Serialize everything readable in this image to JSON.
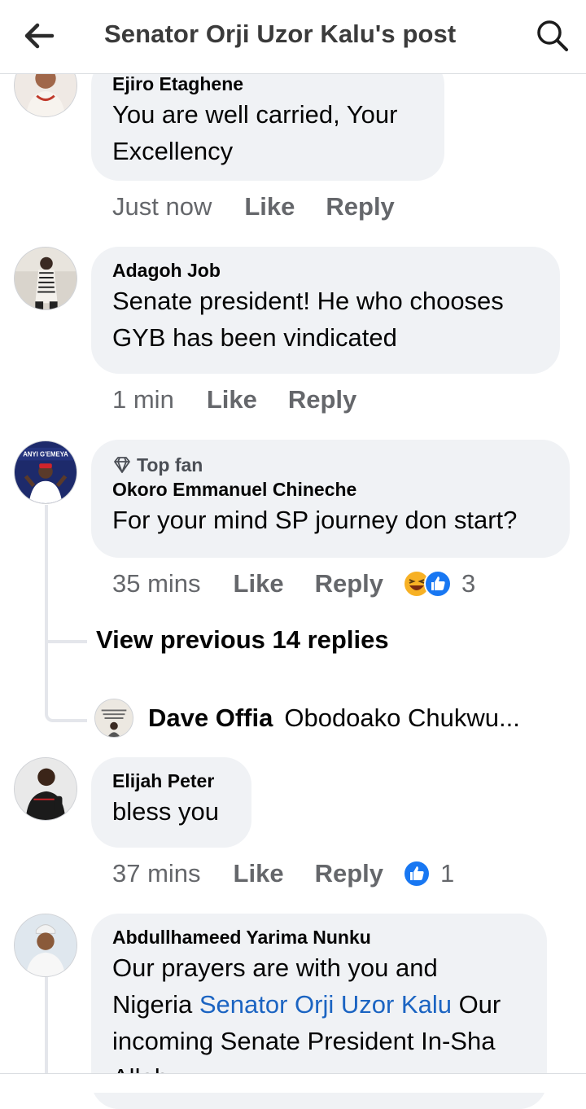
{
  "header": {
    "title": "Senator Orji Uzor Kalu's post"
  },
  "comments": [
    {
      "author": "Ejiro Etaghene",
      "lines": [
        "You are well carried, Your",
        "Excellency"
      ],
      "time": "Just now",
      "like": "Like",
      "reply": "Reply"
    },
    {
      "author": "Adagoh Job",
      "lines": [
        "Senate president! He who chooses",
        "GYB has been vindicated"
      ],
      "time": "1 min",
      "like": "Like",
      "reply": "Reply"
    },
    {
      "badge": "Top fan",
      "author": "Okoro Emmanuel Chineche",
      "lines": [
        "For your mind SP journey don start?"
      ],
      "time": "35 mins",
      "like": "Like",
      "reply": "Reply",
      "reaction_count": "3",
      "reactions": [
        "laugh-reaction",
        "like-reaction"
      ]
    },
    {
      "author": "Elijah Peter",
      "lines": [
        "bless you"
      ],
      "time": "37 mins",
      "like": "Like",
      "reply": "Reply",
      "reaction_count": "1",
      "reactions": [
        "like-reaction"
      ]
    },
    {
      "author": "Abdullhameed Yarima Nunku",
      "line1": "Our prayers are with you and",
      "line2_prefix": "Nigeria ",
      "mention": "Senator Orji Uzor Kalu",
      "line2_suffix": " Our",
      "line3": "incoming Senate President In-Sha",
      "line4": "Allah"
    }
  ],
  "thread": {
    "view_previous": "View previous 14 replies",
    "latest_reply": {
      "author": "Dave Offia",
      "text": "Obodoako Chukwu..."
    }
  },
  "colors": {
    "accent": "#1877f2",
    "mention": "#1b64c2",
    "bubble": "#f0f2f5",
    "meta": "#65676b",
    "laugh": "#f7b125"
  }
}
